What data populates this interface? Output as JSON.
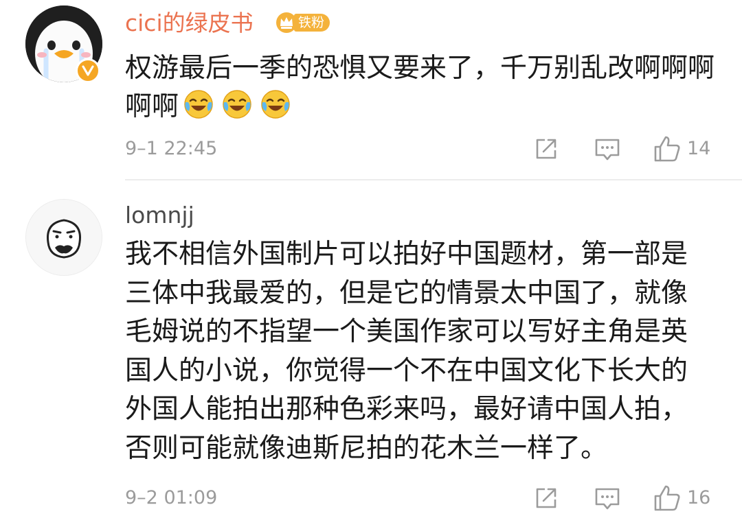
{
  "comments": [
    {
      "username": "cici的绿皮书",
      "badge_label": "铁粉",
      "text": "权游最后一季的恐惧又要来了，千万别乱改啊啊啊啊啊",
      "emojis": [
        "laugh-cry-emoji",
        "laugh-cry-emoji",
        "laugh-cry-emoji"
      ],
      "timestamp": "9–1 22:45",
      "like_count": "14",
      "verified": true
    },
    {
      "username": "lomnjj",
      "text_lines": [
        "我不相信外国制片可以拍好中国题材，第一部是",
        "三体中我最爱的，但是它的情景太中国了，就像",
        "毛姆说的不指望一个美国作家可以写好主角是英",
        "国人的小说，你觉得一个不在中国文化下长大的",
        "外国人能拍出那种色彩来吗，最好请中国人拍，",
        "否则可能就像迪斯尼拍的花木兰一样了。"
      ],
      "timestamp": "9–2 01:09",
      "like_count": "16"
    }
  ],
  "colors": {
    "username_vip": "#eb7350",
    "username_normal": "#4a4a4a",
    "body_text": "#1a1a1a",
    "meta_gray": "#9b9b9b",
    "badge_gold": "#f4b23b",
    "divider": "#ececec"
  },
  "icons": [
    "verified-icon",
    "crown-icon",
    "share-icon",
    "comment-icon",
    "like-icon"
  ]
}
